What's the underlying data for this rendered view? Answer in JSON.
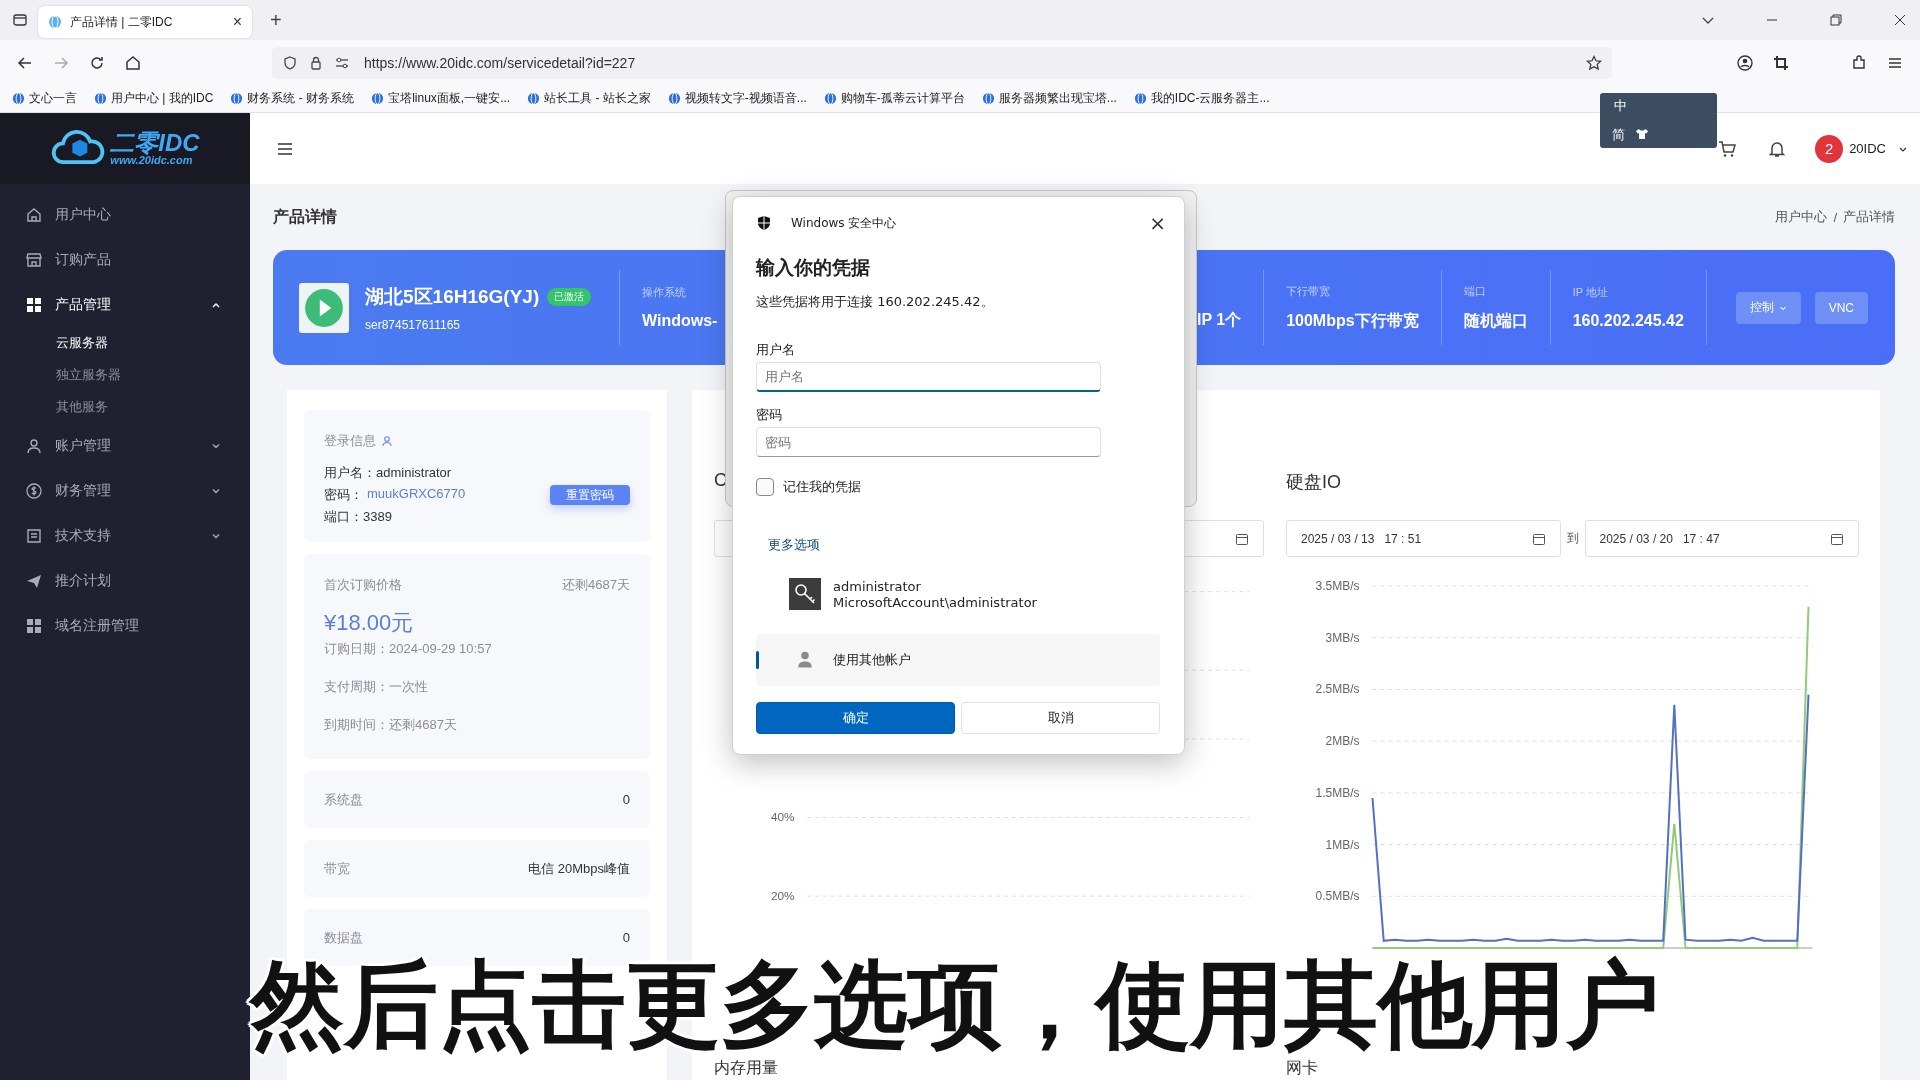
{
  "browser": {
    "tab": {
      "title": "产品详情 | 二零IDC",
      "close": "×"
    },
    "new_tab": "+",
    "url": "https://www.20idc.com/servicedetail?id=227",
    "bookmarks": [
      "文心一言",
      "用户中心 | 我的IDC",
      "财务系统 - 财务系统",
      "宝塔linux面板,一键安...",
      "站长工具 - 站长之家",
      "视频转文字-视频语音...",
      "购物车-孤蒂云计算平台",
      "服务器频繁出现宝塔...",
      "我的IDC-云服务器主..."
    ]
  },
  "ime": {
    "mode": "中",
    "script": "简"
  },
  "sidebar": {
    "logo": {
      "name": "二零IDC",
      "site": "www.20idc.com"
    },
    "items": [
      {
        "label": "用户中心",
        "selected": false
      },
      {
        "label": "订购产品",
        "selected": false
      },
      {
        "label": "产品管理",
        "selected": true,
        "expanded": true,
        "children": [
          {
            "label": "云服务器",
            "selected": true
          },
          {
            "label": "独立服务器",
            "selected": false
          },
          {
            "label": "其他服务",
            "selected": false
          }
        ]
      },
      {
        "label": "账户管理",
        "selected": false,
        "expanded": false
      },
      {
        "label": "财务管理",
        "selected": false,
        "expanded": false
      },
      {
        "label": "技术支持",
        "selected": false,
        "expanded": false
      },
      {
        "label": "推介计划",
        "selected": false
      },
      {
        "label": "域名注册管理",
        "selected": false
      }
    ]
  },
  "header": {
    "avatar": "2",
    "user": "20IDC"
  },
  "page": {
    "title": "产品详情",
    "breadcrumb": [
      "用户中心",
      "产品详情"
    ],
    "separator": "/"
  },
  "product": {
    "name": "湖北5区16H16G(YJ)",
    "badge": "已激活",
    "id": "ser874517611165",
    "info": [
      {
        "label": "操作系统",
        "value": "Windows-"
      },
      {
        "value": "IP 1个"
      },
      {
        "label": "下行带宽",
        "value": "100Mbps下行带宽"
      },
      {
        "label": "端口",
        "value": "随机端口"
      },
      {
        "label": "IP 地址",
        "value": "160.202.245.42"
      }
    ],
    "buttons": [
      {
        "label": "控制",
        "kind": "dropdown"
      },
      {
        "label": "VNC",
        "kind": "plain"
      }
    ]
  },
  "login": {
    "title": "登录信息",
    "username_label": "用户名：",
    "username": "administrator",
    "password_label": "密码：",
    "password": "muukGRXC6770",
    "port_label": "端口：",
    "port": "3389",
    "reset": "重置密码"
  },
  "price": {
    "title": "首次订购价格",
    "remaining": "还剩4687天",
    "amount": "¥18.00元",
    "lines": [
      "订购日期：2024-09-29 10:57",
      "支付周期：一次性",
      "到期时间：还剩4687天"
    ]
  },
  "specs": [
    {
      "label": "系统盘",
      "value": "0"
    },
    {
      "label": "带宽",
      "value": "电信 20Mbps峰值"
    },
    {
      "label": "数据盘",
      "value": "0"
    }
  ],
  "charts": {
    "left": {
      "heading": "C",
      "footer": "内存用量",
      "y_ticks": [
        "40%",
        "20%"
      ]
    },
    "right": {
      "heading": "硬盘IO",
      "from": "2025 / 03 / 13   17 : 51",
      "sep": "到",
      "to": "2025 / 03 / 20   17 : 47",
      "footer": "网卡",
      "chart_data": {
        "type": "line",
        "ylim": [
          0,
          3.5
        ],
        "grid": true,
        "yticks": [
          {
            "value": 3.5,
            "label": "3.5MB/s"
          },
          {
            "value": 3,
            "label": "3MB/s"
          },
          {
            "value": 2.5,
            "label": "2.5MB/s"
          },
          {
            "value": 2,
            "label": "2MB/s"
          },
          {
            "value": 1.5,
            "label": "1.5MB/s"
          },
          {
            "value": 1,
            "label": "1MB/s"
          },
          {
            "value": 0.5,
            "label": "0.5MB/s"
          }
        ],
        "series": [
          {
            "color": "#91cc75",
            "values": [
              0,
              0,
              0,
              0,
              0,
              0,
              0,
              0,
              0,
              0,
              0,
              0,
              0,
              0,
              0,
              0,
              0,
              0,
              0,
              0,
              0,
              0,
              0,
              0,
              0,
              0,
              0,
              1.2,
              0,
              0,
              0,
              0,
              0,
              0,
              0,
              0,
              0,
              0,
              0,
              3.3
            ]
          },
          {
            "color": "#5470c6",
            "values": [
              1.45,
              0.07,
              0.08,
              0.07,
              0.07,
              0.08,
              0.07,
              0.07,
              0.07,
              0.08,
              0.07,
              0.07,
              0.09,
              0.07,
              0.07,
              0.07,
              0.08,
              0.07,
              0.07,
              0.08,
              0.07,
              0.07,
              0.07,
              0.08,
              0.07,
              0.07,
              0.07,
              2.35,
              0.08,
              0.07,
              0.07,
              0.07,
              0.08,
              0.07,
              0.1,
              0.07,
              0.07,
              0.07,
              0.07,
              2.45
            ]
          }
        ]
      }
    }
  },
  "dialog": {
    "app": "Windows 安全中心",
    "close": "×",
    "title": "输入你的凭据",
    "description": "这些凭据将用于连接 160.202.245.42。",
    "username_label": "用户名",
    "username_placeholder": "用户名",
    "password_label": "密码",
    "password_placeholder": "密码",
    "remember": {
      "label": "记住我的凭据",
      "checked": false
    },
    "more": "更多选项",
    "accounts": [
      {
        "kind": "key",
        "name": "administrator",
        "detail": "MicrosoftAccount\\administrator",
        "selected": false
      },
      {
        "kind": "person",
        "name": "使用其他帐户",
        "selected": true
      }
    ],
    "ok": "确定",
    "cancel": "取消"
  },
  "subtitle": "然后点击更多选项，使用其他用户"
}
